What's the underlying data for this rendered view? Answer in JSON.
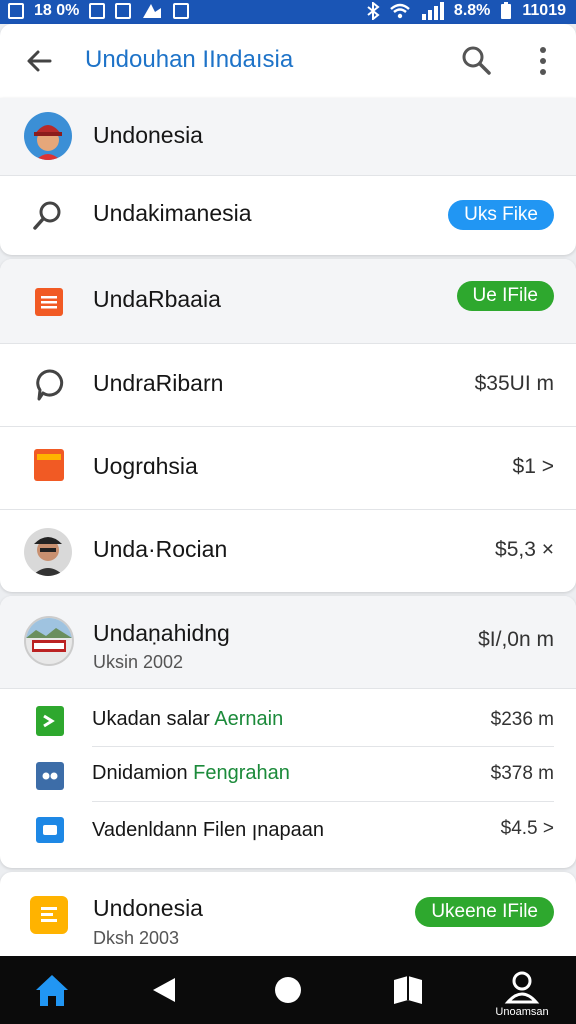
{
  "status": {
    "left_text": "18 0%",
    "battery": "8.8%",
    "time": "11019"
  },
  "appbar": {
    "title": "Undouhan IIndaısia"
  },
  "items": [
    {
      "label": "Undonesia"
    },
    {
      "label": "Undakimanesia",
      "button": "Uks Fike"
    },
    {
      "label": "UndaRbaaia",
      "button": "Ue IFile"
    },
    {
      "label": "UndraRibarn",
      "value": "$35UI m"
    },
    {
      "label": "Uogrɑhsia",
      "value": "$1 >"
    },
    {
      "label": "Unda·Rocian",
      "value": "$5,3 ×"
    },
    {
      "label": "Undaṇahidnɡ",
      "sub": "Uksin 2002",
      "value": "$I/,0n m"
    }
  ],
  "subitems": [
    {
      "label_plain": "Ukadan salar ",
      "label_accent": "Aernain",
      "value": "$236 m"
    },
    {
      "label_plain": "Dnidamion ",
      "label_accent": "Fengrahan",
      "value": "$378 m"
    },
    {
      "label_plain": "Vadenldann Filen ꞁnapaan",
      "label_accent": "",
      "value": "$4.5 >"
    }
  ],
  "last_item": {
    "label": "Undonesia",
    "sub": "Dksh 2003",
    "button": "Ukeene IFile"
  },
  "navbar": {
    "label": "Unoamsan"
  },
  "colors": {
    "accent": "#1e73c8",
    "statusbar": "#1a55b5",
    "blue_pill": "#2196f3",
    "green_pill": "#2ea82e"
  }
}
